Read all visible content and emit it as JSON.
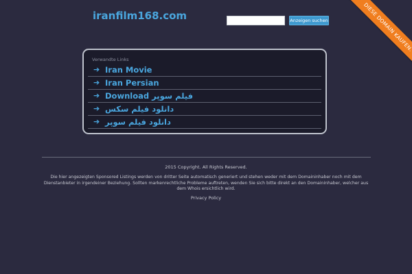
{
  "header": {
    "site_title": "iranfilm168.com"
  },
  "search": {
    "value": "",
    "button_label": "Anzeigen suchen"
  },
  "ribbon": {
    "label": "DIESE DOMAIN KAUFEN."
  },
  "related_links": {
    "heading": "Verwandte Links",
    "items": [
      {
        "arrow": "➔",
        "label": "Iran Movie"
      },
      {
        "arrow": "➔",
        "label": "Iran Persian"
      },
      {
        "arrow": "➔",
        "label": "فیلم سوپر Download"
      },
      {
        "arrow": "➔",
        "label": "دانلود فیلم سکس"
      },
      {
        "arrow": "➔",
        "label": "دانلود فیلم سوپر"
      }
    ]
  },
  "footer": {
    "copyright": "2015 Copyright. All Rights Reserved.",
    "disclaimer": "Die hier angezeigten Sponsored Listings werden von dritter Seite automatisch generiert und stehen weder mit dem Domaininhaber noch mit dem Dienstanbieter in irgendeiner Beziehung. Sollten markenrechtliche Probleme auftreten, wenden Sie sich bitte direkt an den Domaininhaber, welcher aus dem Whois ersichtlich wird.",
    "privacy_label": "Privacy Policy"
  },
  "colors": {
    "background": "#2b2a3f",
    "accent": "#4aa6de",
    "ribbon": "#f07e1f"
  }
}
